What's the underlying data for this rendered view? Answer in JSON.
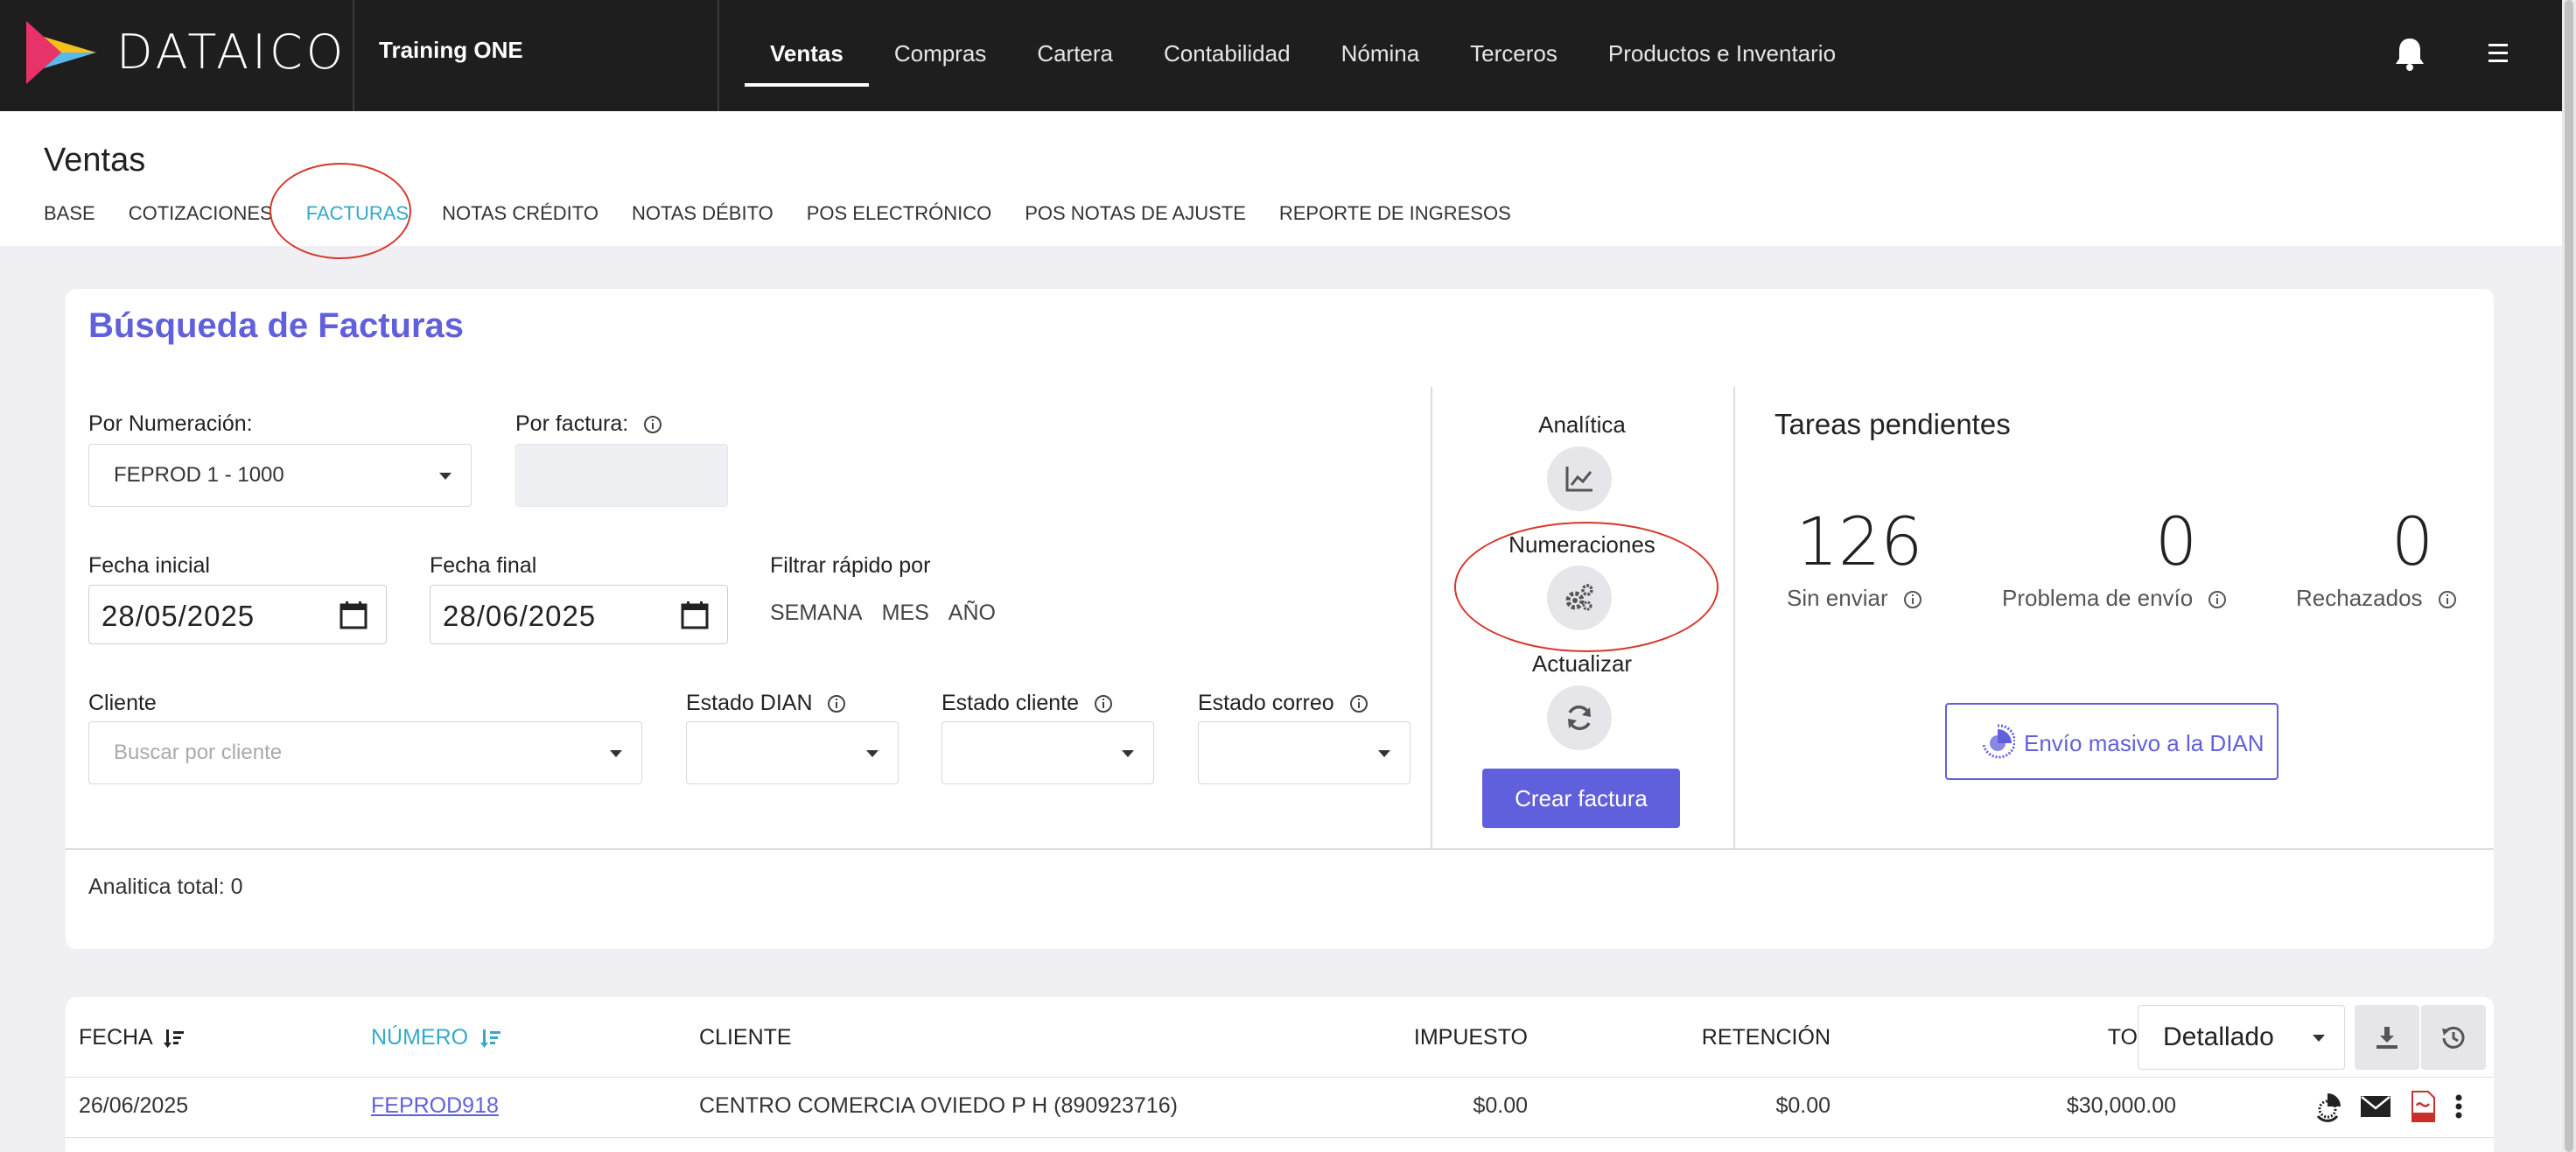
{
  "brand": {
    "name": "DATAICO"
  },
  "company": {
    "name": "Training ONE"
  },
  "nav": {
    "items": [
      {
        "label": "Ventas",
        "active": true
      },
      {
        "label": "Compras"
      },
      {
        "label": "Cartera"
      },
      {
        "label": "Contabilidad"
      },
      {
        "label": "Nómina"
      },
      {
        "label": "Terceros"
      },
      {
        "label": "Productos e Inventario"
      }
    ]
  },
  "page": {
    "title": "Ventas",
    "tabs": [
      {
        "label": "BASE"
      },
      {
        "label": "COTIZACIONES"
      },
      {
        "label": "FACTURAS",
        "active": true
      },
      {
        "label": "NOTAS CRÉDITO"
      },
      {
        "label": "NOTAS DÉBITO"
      },
      {
        "label": "POS ELECTRÓNICO"
      },
      {
        "label": "POS NOTAS DE AJUSTE"
      },
      {
        "label": "REPORTE DE INGRESOS"
      }
    ]
  },
  "search": {
    "title": "Búsqueda de Facturas",
    "numeracion_label": "Por Numeración:",
    "numeracion_value": "FEPROD 1 - 1000",
    "factura_label": "Por factura:",
    "fecha_inicial_label": "Fecha inicial",
    "fecha_inicial_value": "28/05/2025",
    "fecha_final_label": "Fecha final",
    "fecha_final_value": "28/06/2025",
    "filtrar_label": "Filtrar rápido por",
    "quick_filters": [
      "SEMANA",
      "MES",
      "AÑO"
    ],
    "cliente_label": "Cliente",
    "cliente_placeholder": "Buscar por cliente",
    "estado_dian_label": "Estado DIAN",
    "estado_cliente_label": "Estado cliente",
    "estado_correo_label": "Estado correo",
    "analitica_total": "Analitica total: 0"
  },
  "actions": {
    "analitica": "Analítica",
    "numeraciones": "Numeraciones",
    "actualizar": "Actualizar",
    "crear_factura": "Crear factura"
  },
  "tasks": {
    "title": "Tareas pendientes",
    "stats": [
      {
        "value": "126",
        "label": "Sin enviar"
      },
      {
        "value": "0",
        "label": "Problema de envío"
      },
      {
        "value": "0",
        "label": "Rechazados"
      }
    ],
    "envio_masivo": "Envío masivo a la DIAN"
  },
  "table": {
    "headers": {
      "fecha": "FECHA",
      "numero": "NÚMERO",
      "cliente": "CLIENTE",
      "impuesto": "IMPUESTO",
      "retencion": "RETENCIÓN",
      "total": "TOTAL"
    },
    "view_mode": "Detallado",
    "rows": [
      {
        "fecha": "26/06/2025",
        "numero": "FEPROD918",
        "cliente": "CENTRO COMERCIA OVIEDO P H (890923716)",
        "impuesto": "$0.00",
        "retencion": "$0.00",
        "total": "$30,000.00"
      }
    ]
  },
  "colors": {
    "accent_purple": "#6160dc",
    "accent_teal": "#36a9c9",
    "annotation_red": "#d6372b",
    "navbar": "#1e1e1e"
  }
}
